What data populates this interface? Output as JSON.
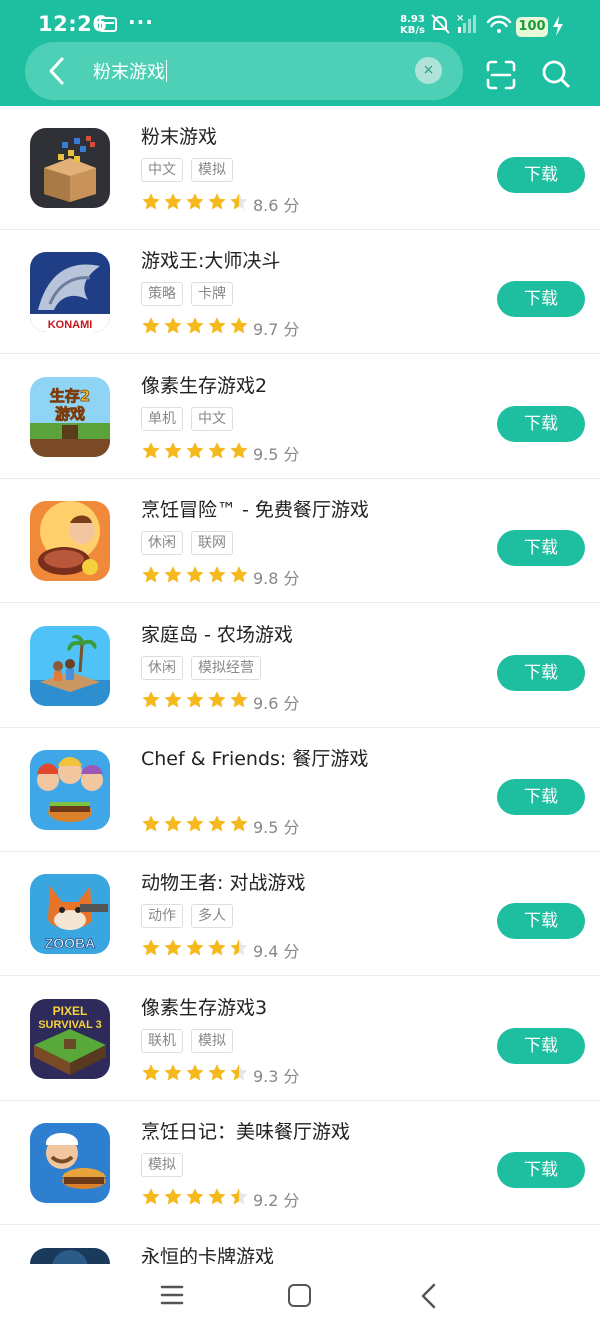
{
  "status_bar": {
    "time": "12:26",
    "more": "···",
    "net_speed_value": "8.93",
    "net_speed_unit": "KB/s",
    "battery": "100",
    "icons": [
      "notification-card-icon",
      "mute-icon",
      "signal-icon",
      "wifi-icon",
      "battery-icon",
      "charging-icon"
    ]
  },
  "search": {
    "query": "粉末游戏",
    "clear_label": "×"
  },
  "colors": {
    "brand": "#1ebea0",
    "search_fill": "#4ed0b7",
    "star": "#f5b81d",
    "star_empty": "#e6e6e6"
  },
  "results": [
    {
      "title": "粉末游戏",
      "tags": [
        "中文",
        "模拟"
      ],
      "rating": 4.5,
      "score": "8.6 分",
      "button": "下载",
      "icon": "powder-box-icon"
    },
    {
      "title": "游戏王:大师决斗",
      "tags": [
        "策略",
        "卡牌"
      ],
      "rating": 5,
      "score": "9.7 分",
      "button": "下载",
      "icon": "dragon-konami-icon",
      "icon_text": "KONAMI"
    },
    {
      "title": "像素生存游戏2",
      "tags": [
        "单机",
        "中文"
      ],
      "rating": 5,
      "score": "9.5 分",
      "button": "下载",
      "icon": "pixel-survival-2-icon",
      "icon_text": "生存2 游戏"
    },
    {
      "title": "烹饪冒险™ - 免费餐厅游戏",
      "tags": [
        "休闲",
        "联网"
      ],
      "rating": 5,
      "score": "9.8 分",
      "button": "下载",
      "icon": "cooking-adventure-icon"
    },
    {
      "title": "家庭岛 - 农场游戏",
      "tags": [
        "休闲",
        "模拟经营"
      ],
      "rating": 5,
      "score": "9.6 分",
      "button": "下载",
      "icon": "family-island-icon"
    },
    {
      "title": "Chef & Friends: 餐厅游戏",
      "tags": [],
      "rating": 5,
      "score": "9.5 分",
      "button": "下载",
      "icon": "chef-friends-icon"
    },
    {
      "title": "动物王者: 对战游戏",
      "tags": [
        "动作",
        "多人"
      ],
      "rating": 4.5,
      "score": "9.4 分",
      "button": "下载",
      "icon": "zooba-icon",
      "icon_text": "ZOOBA"
    },
    {
      "title": "像素生存游戏3",
      "tags": [
        "联机",
        "模拟"
      ],
      "rating": 4.5,
      "score": "9.3 分",
      "button": "下载",
      "icon": "pixel-survival-3-icon",
      "icon_text": "PIXEL SURVIVAL 3"
    },
    {
      "title": "烹饪日记：美味餐厅游戏",
      "tags": [
        "模拟"
      ],
      "rating": 4.5,
      "score": "9.2 分",
      "button": "下载",
      "icon": "cooking-diary-icon"
    },
    {
      "title": "永恒的卡牌游戏",
      "tags": [],
      "rating": null,
      "score": "",
      "button": "",
      "icon": "eternal-card-icon"
    }
  ],
  "nav_bar": {
    "icons": [
      "menu-icon",
      "home-icon",
      "back-icon"
    ]
  }
}
